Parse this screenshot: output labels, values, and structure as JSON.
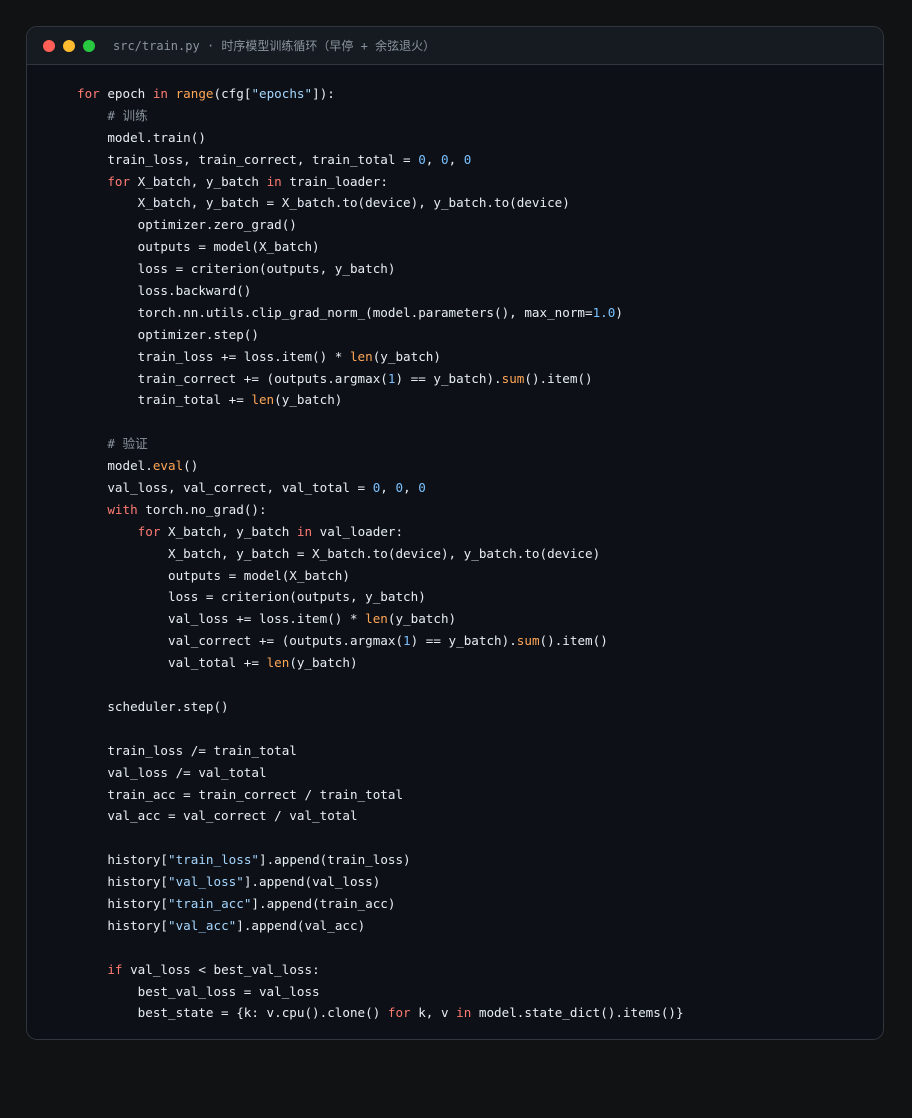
{
  "window": {
    "title_path": "src/train.py",
    "title_separator": "·",
    "title_desc": "时序模型训练循环（早停 + 余弦退火）"
  },
  "colors": {
    "page_bg": "#111214",
    "editor_bg": "#0d1117",
    "titlebar_bg": "#161b22",
    "border": "#30363d",
    "traffic_red": "#ff5f57",
    "traffic_yellow": "#febc2e",
    "traffic_green": "#28c840",
    "keyword": "#ff7b72",
    "builtin": "#ffa657",
    "number": "#79c0ff",
    "string": "#a5d6ff",
    "comment": "#8b949e",
    "text": "#e6edf3"
  },
  "code": {
    "lines": [
      [
        {
          "t": "kw",
          "v": "for"
        },
        {
          "t": "tx",
          "v": " epoch "
        },
        {
          "t": "kw",
          "v": "in"
        },
        {
          "t": "tx",
          "v": " "
        },
        {
          "t": "fn",
          "v": "range"
        },
        {
          "t": "tx",
          "v": "(cfg["
        },
        {
          "t": "str",
          "v": "\"epochs\""
        },
        {
          "t": "tx",
          "v": "]):"
        }
      ],
      [
        {
          "t": "tx",
          "v": "    "
        },
        {
          "t": "cm",
          "v": "# 训练"
        }
      ],
      [
        {
          "t": "tx",
          "v": "    model.train()"
        }
      ],
      [
        {
          "t": "tx",
          "v": "    train_loss, train_correct, train_total = "
        },
        {
          "t": "num",
          "v": "0"
        },
        {
          "t": "tx",
          "v": ", "
        },
        {
          "t": "num",
          "v": "0"
        },
        {
          "t": "tx",
          "v": ", "
        },
        {
          "t": "num",
          "v": "0"
        }
      ],
      [
        {
          "t": "tx",
          "v": "    "
        },
        {
          "t": "kw",
          "v": "for"
        },
        {
          "t": "tx",
          "v": " X_batch, y_batch "
        },
        {
          "t": "kw",
          "v": "in"
        },
        {
          "t": "tx",
          "v": " train_loader:"
        }
      ],
      [
        {
          "t": "tx",
          "v": "        X_batch, y_batch = X_batch.to(device), y_batch.to(device)"
        }
      ],
      [
        {
          "t": "tx",
          "v": "        optimizer.zero_grad()"
        }
      ],
      [
        {
          "t": "tx",
          "v": "        outputs = model(X_batch)"
        }
      ],
      [
        {
          "t": "tx",
          "v": "        loss = criterion(outputs, y_batch)"
        }
      ],
      [
        {
          "t": "tx",
          "v": "        loss.backward()"
        }
      ],
      [
        {
          "t": "tx",
          "v": "        torch.nn.utils.clip_grad_norm_(model.parameters(), max_norm="
        },
        {
          "t": "num",
          "v": "1.0"
        },
        {
          "t": "tx",
          "v": ")"
        }
      ],
      [
        {
          "t": "tx",
          "v": "        optimizer.step()"
        }
      ],
      [
        {
          "t": "tx",
          "v": "        train_loss += loss.item() * "
        },
        {
          "t": "fn",
          "v": "len"
        },
        {
          "t": "tx",
          "v": "(y_batch)"
        }
      ],
      [
        {
          "t": "tx",
          "v": "        train_correct += (outputs.argmax("
        },
        {
          "t": "num",
          "v": "1"
        },
        {
          "t": "tx",
          "v": ") == y_batch)."
        },
        {
          "t": "fn",
          "v": "sum"
        },
        {
          "t": "tx",
          "v": "().item()"
        }
      ],
      [
        {
          "t": "tx",
          "v": "        train_total += "
        },
        {
          "t": "fn",
          "v": "len"
        },
        {
          "t": "tx",
          "v": "(y_batch)"
        }
      ],
      [],
      [
        {
          "t": "tx",
          "v": "    "
        },
        {
          "t": "cm",
          "v": "# 验证"
        }
      ],
      [
        {
          "t": "tx",
          "v": "    model."
        },
        {
          "t": "fn",
          "v": "eval"
        },
        {
          "t": "tx",
          "v": "()"
        }
      ],
      [
        {
          "t": "tx",
          "v": "    val_loss, val_correct, val_total = "
        },
        {
          "t": "num",
          "v": "0"
        },
        {
          "t": "tx",
          "v": ", "
        },
        {
          "t": "num",
          "v": "0"
        },
        {
          "t": "tx",
          "v": ", "
        },
        {
          "t": "num",
          "v": "0"
        }
      ],
      [
        {
          "t": "tx",
          "v": "    "
        },
        {
          "t": "kw",
          "v": "with"
        },
        {
          "t": "tx",
          "v": " torch.no_grad():"
        }
      ],
      [
        {
          "t": "tx",
          "v": "        "
        },
        {
          "t": "kw",
          "v": "for"
        },
        {
          "t": "tx",
          "v": " X_batch, y_batch "
        },
        {
          "t": "kw",
          "v": "in"
        },
        {
          "t": "tx",
          "v": " val_loader:"
        }
      ],
      [
        {
          "t": "tx",
          "v": "            X_batch, y_batch = X_batch.to(device), y_batch.to(device)"
        }
      ],
      [
        {
          "t": "tx",
          "v": "            outputs = model(X_batch)"
        }
      ],
      [
        {
          "t": "tx",
          "v": "            loss = criterion(outputs, y_batch)"
        }
      ],
      [
        {
          "t": "tx",
          "v": "            val_loss += loss.item() * "
        },
        {
          "t": "fn",
          "v": "len"
        },
        {
          "t": "tx",
          "v": "(y_batch)"
        }
      ],
      [
        {
          "t": "tx",
          "v": "            val_correct += (outputs.argmax("
        },
        {
          "t": "num",
          "v": "1"
        },
        {
          "t": "tx",
          "v": ") == y_batch)."
        },
        {
          "t": "fn",
          "v": "sum"
        },
        {
          "t": "tx",
          "v": "().item()"
        }
      ],
      [
        {
          "t": "tx",
          "v": "            val_total += "
        },
        {
          "t": "fn",
          "v": "len"
        },
        {
          "t": "tx",
          "v": "(y_batch)"
        }
      ],
      [],
      [
        {
          "t": "tx",
          "v": "    scheduler.step()"
        }
      ],
      [],
      [
        {
          "t": "tx",
          "v": "    train_loss /= train_total"
        }
      ],
      [
        {
          "t": "tx",
          "v": "    val_loss /= val_total"
        }
      ],
      [
        {
          "t": "tx",
          "v": "    train_acc = train_correct / train_total"
        }
      ],
      [
        {
          "t": "tx",
          "v": "    val_acc = val_correct / val_total"
        }
      ],
      [],
      [
        {
          "t": "tx",
          "v": "    history["
        },
        {
          "t": "str",
          "v": "\"train_loss\""
        },
        {
          "t": "tx",
          "v": "].append(train_loss)"
        }
      ],
      [
        {
          "t": "tx",
          "v": "    history["
        },
        {
          "t": "str",
          "v": "\"val_loss\""
        },
        {
          "t": "tx",
          "v": "].append(val_loss)"
        }
      ],
      [
        {
          "t": "tx",
          "v": "    history["
        },
        {
          "t": "str",
          "v": "\"train_acc\""
        },
        {
          "t": "tx",
          "v": "].append(train_acc)"
        }
      ],
      [
        {
          "t": "tx",
          "v": "    history["
        },
        {
          "t": "str",
          "v": "\"val_acc\""
        },
        {
          "t": "tx",
          "v": "].append(val_acc)"
        }
      ],
      [],
      [
        {
          "t": "tx",
          "v": "    "
        },
        {
          "t": "kw",
          "v": "if"
        },
        {
          "t": "tx",
          "v": " val_loss < best_val_loss:"
        }
      ],
      [
        {
          "t": "tx",
          "v": "        best_val_loss = val_loss"
        }
      ],
      [
        {
          "t": "tx",
          "v": "        best_state = {k: v.cpu().clone() "
        },
        {
          "t": "kw",
          "v": "for"
        },
        {
          "t": "tx",
          "v": " k, v "
        },
        {
          "t": "kw",
          "v": "in"
        },
        {
          "t": "tx",
          "v": " model.state_dict().items()}"
        }
      ]
    ]
  }
}
